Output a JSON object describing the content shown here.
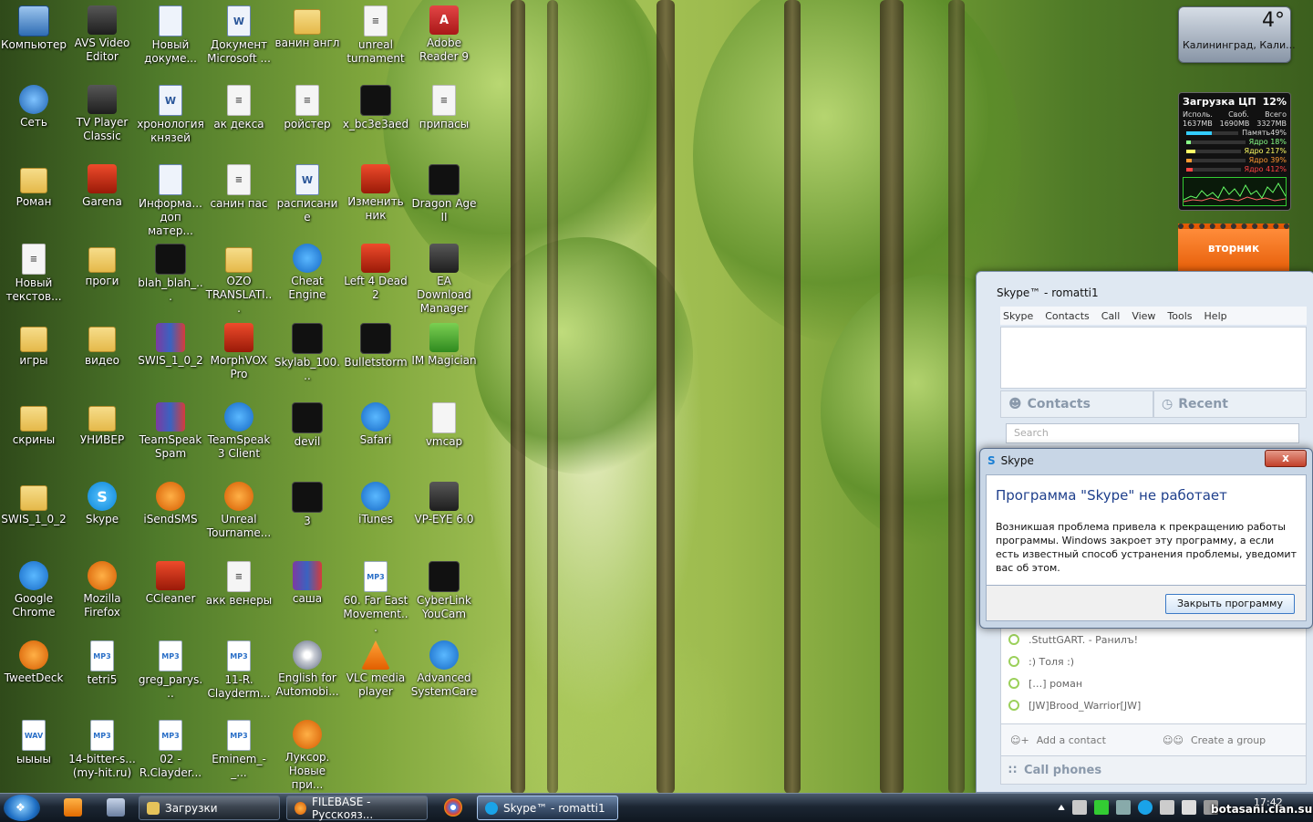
{
  "desktop": {
    "icons": [
      {
        "label": "Компьютер",
        "icon": "computer-icon"
      },
      {
        "label": "AVS Video Editor",
        "icon": "video-editor-icon"
      },
      {
        "label": "Новый докуме...",
        "icon": "document-icon"
      },
      {
        "label": "Документ Microsoft ...",
        "icon": "word-document-icon"
      },
      {
        "label": "ванин англ",
        "icon": "folder-icon"
      },
      {
        "label": "unreal turnament",
        "icon": "text-file-icon"
      },
      {
        "label": "Adobe Reader 9",
        "icon": "pdf-reader-icon"
      },
      {
        "label": "Сеть",
        "icon": "network-icon"
      },
      {
        "label": "TV Player Classic",
        "icon": "tv-player-icon"
      },
      {
        "label": "хронология князей",
        "icon": "word-document-icon"
      },
      {
        "label": "ак декса",
        "icon": "text-file-icon"
      },
      {
        "label": "ройстер",
        "icon": "text-file-icon"
      },
      {
        "label": "x_bc3e3aed",
        "icon": "image-file-icon"
      },
      {
        "label": "припасы",
        "icon": "text-file-icon"
      },
      {
        "label": "Роман",
        "icon": "user-folder-icon"
      },
      {
        "label": "Garena",
        "icon": "garena-icon"
      },
      {
        "label": "Информа... доп матер...",
        "icon": "document-icon"
      },
      {
        "label": "санин пас",
        "icon": "text-file-icon"
      },
      {
        "label": "расписание",
        "icon": "word-document-icon"
      },
      {
        "label": "Изменить ник",
        "icon": "left4dead-icon"
      },
      {
        "label": "Dragon Age II",
        "icon": "dragon-age-icon"
      },
      {
        "label": "Новый текстов...",
        "icon": "text-file-icon"
      },
      {
        "label": "проги",
        "icon": "folder-icon"
      },
      {
        "label": "blah_blah_...",
        "icon": "image-file-icon"
      },
      {
        "label": "OZO TRANSLATI...",
        "icon": "folder-icon"
      },
      {
        "label": "Cheat Engine",
        "icon": "cheat-engine-icon"
      },
      {
        "label": "Left 4 Dead 2",
        "icon": "left4dead-icon"
      },
      {
        "label": "EA Download Manager",
        "icon": "ea-icon"
      },
      {
        "label": "игры",
        "icon": "folder-icon"
      },
      {
        "label": "видео",
        "icon": "folder-icon"
      },
      {
        "label": "SWIS_1_0_2",
        "icon": "archive-icon"
      },
      {
        "label": "MorphVOX Pro",
        "icon": "morphvox-icon"
      },
      {
        "label": "Skylab_100...",
        "icon": "image-file-icon"
      },
      {
        "label": "Bulletstorm",
        "icon": "bulletstorm-icon"
      },
      {
        "label": "IM Magician",
        "icon": "im-magician-icon"
      },
      {
        "label": "скрины",
        "icon": "folder-icon"
      },
      {
        "label": "УНИВЕР",
        "icon": "folder-icon"
      },
      {
        "label": "TeamSpeak Spam",
        "icon": "archive-icon"
      },
      {
        "label": "TeamSpeak 3 Client",
        "icon": "teamspeak-icon"
      },
      {
        "label": "devil",
        "icon": "image-file-icon"
      },
      {
        "label": "Safari",
        "icon": "safari-icon"
      },
      {
        "label": "vmcap",
        "icon": "vmcap-icon"
      },
      {
        "label": "SWIS_1_0_2",
        "icon": "folder-icon"
      },
      {
        "label": "Skype",
        "icon": "skype-icon"
      },
      {
        "label": "iSendSMS",
        "icon": "isendsms-icon"
      },
      {
        "label": "Unreal Tourname...",
        "icon": "unreal-icon"
      },
      {
        "label": "3",
        "icon": "image-file-icon"
      },
      {
        "label": "iTunes",
        "icon": "itunes-icon"
      },
      {
        "label": "VP-EYE 6.0",
        "icon": "vp-eye-icon"
      },
      {
        "label": "Google Chrome",
        "icon": "chrome-icon"
      },
      {
        "label": "Mozilla Firefox",
        "icon": "firefox-icon"
      },
      {
        "label": "CCleaner",
        "icon": "ccleaner-icon"
      },
      {
        "label": "акк венеры",
        "icon": "text-file-icon"
      },
      {
        "label": "саша",
        "icon": "archive-icon"
      },
      {
        "label": "60. Far East Movement...",
        "icon": "mp3-file-icon"
      },
      {
        "label": "CyberLink YouCam",
        "icon": "youcam-icon"
      },
      {
        "label": "TweetDeck",
        "icon": "tweetdeck-icon"
      },
      {
        "label": "tetri5",
        "icon": "mp3-file-icon"
      },
      {
        "label": "greg_parys...",
        "icon": "mp3-file-icon"
      },
      {
        "label": "11-R. Clayderm...",
        "icon": "mp3-file-icon"
      },
      {
        "label": "English for Automobi...",
        "icon": "cd-icon"
      },
      {
        "label": "VLC media player",
        "icon": "vlc-icon"
      },
      {
        "label": "Advanced SystemCare",
        "icon": "systemcare-icon"
      },
      {
        "label": "ыыыы",
        "icon": "wav-file-icon"
      },
      {
        "label": "14-bitter-s... (my-hit.ru)",
        "icon": "mp3-file-icon"
      },
      {
        "label": "02 - R.Clayder...",
        "icon": "mp3-file-icon"
      },
      {
        "label": "Eminem_-_...",
        "icon": "mp3-file-icon"
      },
      {
        "label": "Луксор. Новые при...",
        "icon": "luxor-icon"
      }
    ]
  },
  "gadgets": {
    "weather": {
      "temp": "4°",
      "city": "Калининград, Кали..."
    },
    "cpu": {
      "title": "Загрузка ЦП",
      "value": "12%",
      "h_used": "Исполь.",
      "h_free": "Своб.",
      "h_total": "Всего",
      "used": "1637MB",
      "free": "1690MB",
      "total": "3327MB",
      "mem_label": "Память",
      "mem_value": "49%",
      "mem_fill": 0.49,
      "cores": [
        {
          "label": "Ядро 1",
          "value": "8%",
          "fill": 0.08,
          "color": "#8f8"
        },
        {
          "label": "Ядро 2",
          "value": "17%",
          "fill": 0.17,
          "color": "#ff6"
        },
        {
          "label": "Ядро 3",
          "value": "9%",
          "fill": 0.09,
          "color": "#f93"
        },
        {
          "label": "Ядро 4",
          "value": "12%",
          "fill": 0.12,
          "color": "#f44"
        }
      ]
    },
    "calendar": {
      "day": "вторник"
    }
  },
  "skype": {
    "title": "Skype™ - romatti1",
    "menu": [
      "Skype",
      "Contacts",
      "Call",
      "View",
      "Tools",
      "Help"
    ],
    "tab_contacts": "Contacts",
    "tab_recent": "Recent",
    "search_placeholder": "Search",
    "contacts": [
      ".StuttGART. - Ранилъ!",
      ":) Толя :)",
      "[…] роман",
      "[JW]Brood_Warrior[JW]"
    ],
    "add_contact": "Add a contact",
    "create_group": "Create a group",
    "call_phones": "Call phones"
  },
  "dialog": {
    "title": "Skype",
    "heading": "Программа \"Skype\" не работает",
    "message": "Возникшая проблема привела к прекращению работы программы. Windows закроет эту программу, а если есть известный способ устранения проблемы, уведомит вас об этом.",
    "button": "Закрыть программу",
    "close_glyph": "x"
  },
  "taskbar": {
    "tasks": [
      {
        "label": "Загрузки"
      },
      {
        "label": "FILEBASE - Русскояз..."
      },
      {
        "label": "Skype™ - romatti1"
      }
    ],
    "clock": "17:42"
  },
  "watermark": "botasani.clan.su"
}
